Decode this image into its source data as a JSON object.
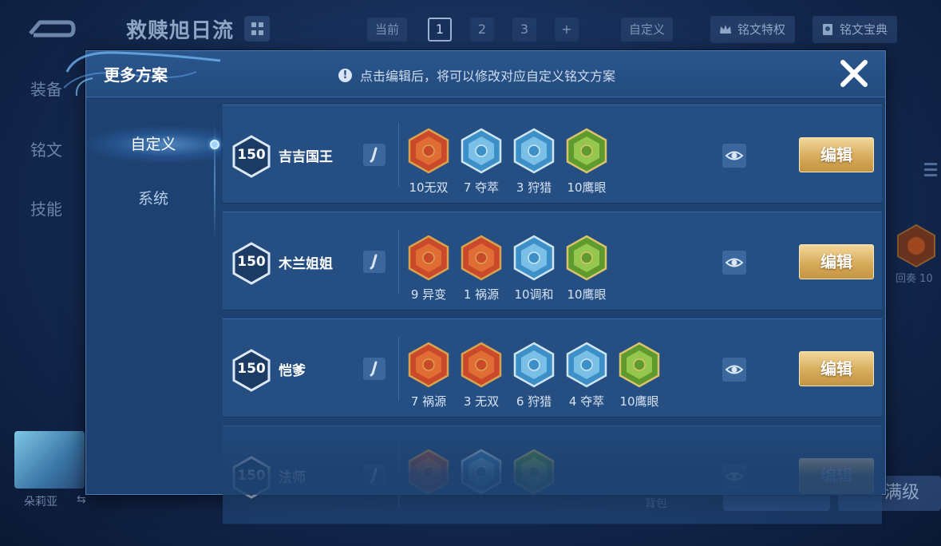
{
  "background": {
    "hero_title": "救赎旭日流",
    "current_label": "当前",
    "pages": [
      "1",
      "2",
      "3",
      "+"
    ],
    "custom_label": "自定义",
    "privilege_btn": "铭文特权",
    "codex_btn": "铭文宝典",
    "side_menu": [
      "装备",
      "铭文",
      "技能"
    ],
    "hero_name": "朵莉亚",
    "bag_label": "背包",
    "max_btn": "满级",
    "right_rune_label": "回奏 10"
  },
  "dialog": {
    "title": "更多方案",
    "notice": "点击编辑后，将可以修改对应自定义铭文方案",
    "tabs": {
      "custom": "自定义",
      "system": "系统"
    },
    "edit_label": "编辑",
    "schemes": [
      {
        "level": "150",
        "name": "吉吉国王",
        "runes": [
          {
            "label": "10无双",
            "color": "red"
          },
          {
            "label": "7 夺萃",
            "color": "blue"
          },
          {
            "label": "3 狩猎",
            "color": "blue"
          },
          {
            "label": "10鹰眼",
            "color": "green"
          }
        ]
      },
      {
        "level": "150",
        "name": "木兰姐姐",
        "runes": [
          {
            "label": "9 异变",
            "color": "red"
          },
          {
            "label": "1 祸源",
            "color": "red"
          },
          {
            "label": "10调和",
            "color": "blue"
          },
          {
            "label": "10鹰眼",
            "color": "green"
          }
        ]
      },
      {
        "level": "150",
        "name": "恺爹",
        "runes": [
          {
            "label": "7 祸源",
            "color": "red"
          },
          {
            "label": "3 无双",
            "color": "red"
          },
          {
            "label": "6 狩猎",
            "color": "blue"
          },
          {
            "label": "4 夺萃",
            "color": "blue"
          },
          {
            "label": "10鹰眼",
            "color": "green"
          }
        ]
      },
      {
        "level": "150",
        "name": "法师",
        "runes": [
          {
            "label": "",
            "color": "red"
          },
          {
            "label": "",
            "color": "blue"
          },
          {
            "label": "",
            "color": "green"
          }
        ]
      }
    ]
  },
  "colors": {
    "red": "#d4532a",
    "blue": "#5aa8d8",
    "green": "#7eb33c",
    "gold": "#d7ac5c",
    "accent": "#6cc3ff"
  }
}
